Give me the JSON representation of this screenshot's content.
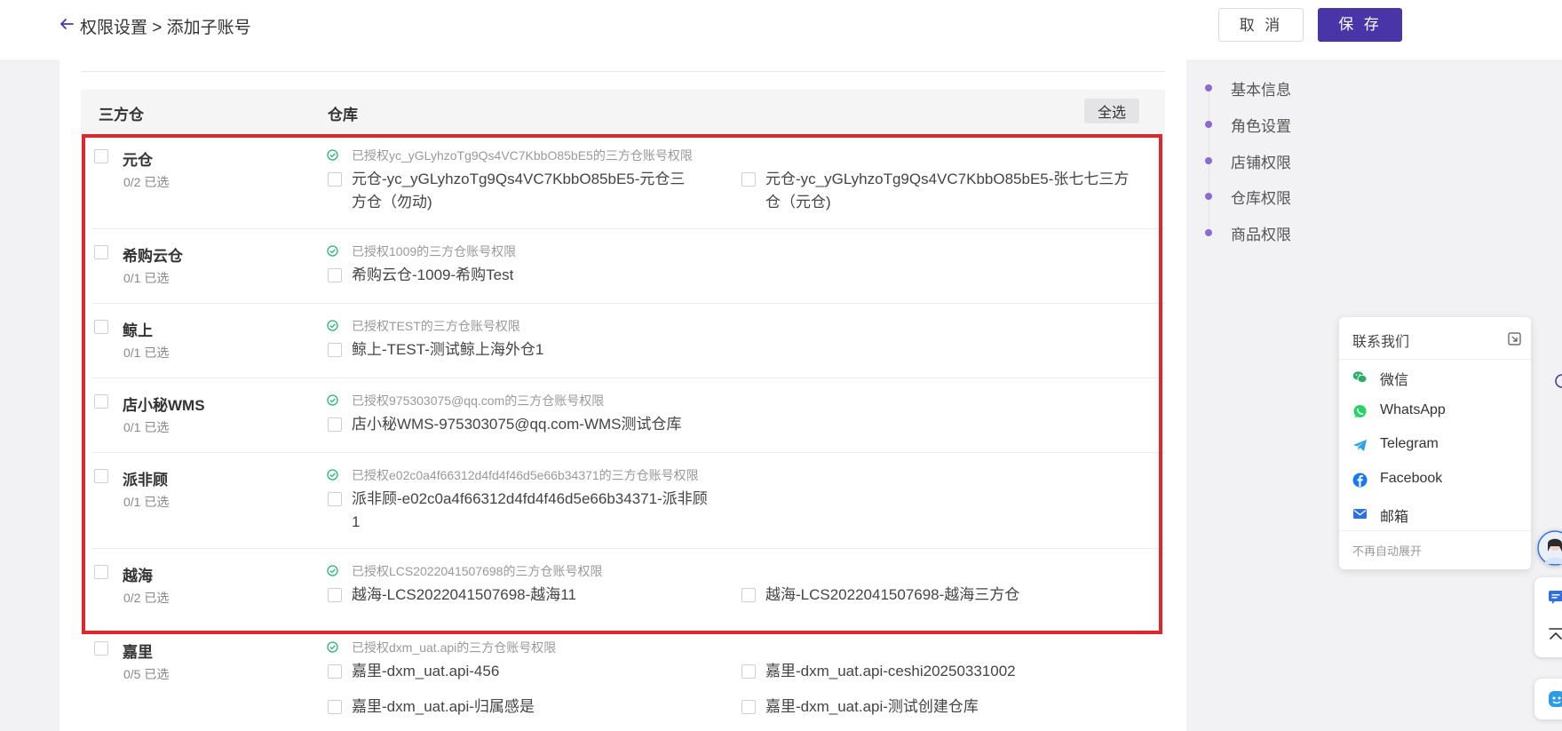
{
  "header": {
    "breadcrumb": "权限设置 > 添加子账号",
    "cancel_label": "取 消",
    "save_label": "保 存"
  },
  "table": {
    "col_warehouse3pl": "三方仓",
    "col_warehouse": "仓库",
    "select_all": "全选"
  },
  "groups": [
    {
      "name": "元仓",
      "count": "0/2 已选",
      "auth": "已授权yc_yGLyhzoTg9Qs4VC7KbbO85bE5的三方仓账号权限",
      "options": [
        "元仓-yc_yGLyhzoTg9Qs4VC7KbbO85bE5-元仓三方仓（勿动)",
        "元仓-yc_yGLyhzoTg9Qs4VC7KbbO85bE5-张七七三方仓（元仓)"
      ]
    },
    {
      "name": "希购云仓",
      "count": "0/1 已选",
      "auth": "已授权1009的三方仓账号权限",
      "options": [
        "希购云仓-1009-希购Test"
      ]
    },
    {
      "name": "鲸上",
      "count": "0/1 已选",
      "auth": "已授权TEST的三方仓账号权限",
      "options": [
        "鲸上-TEST-测试鲸上海外仓1"
      ]
    },
    {
      "name": "店小秘WMS",
      "count": "0/1 已选",
      "auth": "已授权975303075@qq.com的三方仓账号权限",
      "options": [
        "店小秘WMS-975303075@qq.com-WMS测试仓库"
      ]
    },
    {
      "name": "派非顾",
      "count": "0/1 已选",
      "auth": "已授权e02c0a4f66312d4fd4f46d5e66b34371的三方仓账号权限",
      "options": [
        "派非顾-e02c0a4f66312d4fd4f46d5e66b34371-派非顾1"
      ]
    },
    {
      "name": "越海",
      "count": "0/2 已选",
      "auth": "已授权LCS2022041507698的三方仓账号权限",
      "options": [
        "越海-LCS2022041507698-越海11",
        "越海-LCS2022041507698-越海三方仓"
      ]
    },
    {
      "name": "嘉里",
      "count": "0/5 已选",
      "auth": "已授权dxm_uat.api的三方仓账号权限",
      "options": [
        "嘉里-dxm_uat.api-456",
        "嘉里-dxm_uat.api-ceshi20250331002",
        "嘉里-dxm_uat.api-归属感是",
        "嘉里-dxm_uat.api-测试创建仓库"
      ]
    }
  ],
  "anchors": [
    "基本信息",
    "角色设置",
    "店铺权限",
    "仓库权限",
    "商品权限"
  ],
  "contact": {
    "title": "联系我们",
    "items": [
      {
        "label": "微信",
        "icon": "wechat-icon",
        "color": "#2aae67"
      },
      {
        "label": "WhatsApp",
        "icon": "whatsapp-icon",
        "color": "#25d366"
      },
      {
        "label": "Telegram",
        "icon": "telegram-icon",
        "color": "#2aa3df"
      },
      {
        "label": "Facebook",
        "icon": "facebook-icon",
        "color": "#1877f2"
      },
      {
        "label": "邮箱",
        "icon": "mail-icon",
        "color": "#2f6fe0"
      }
    ],
    "no_auto_expand": "不再自动展开"
  },
  "colors": {
    "primary": "#4a35a8",
    "highlight": "#e0262b",
    "check_green": "#2bb673",
    "anchor_dot": "#8a6bd1"
  }
}
